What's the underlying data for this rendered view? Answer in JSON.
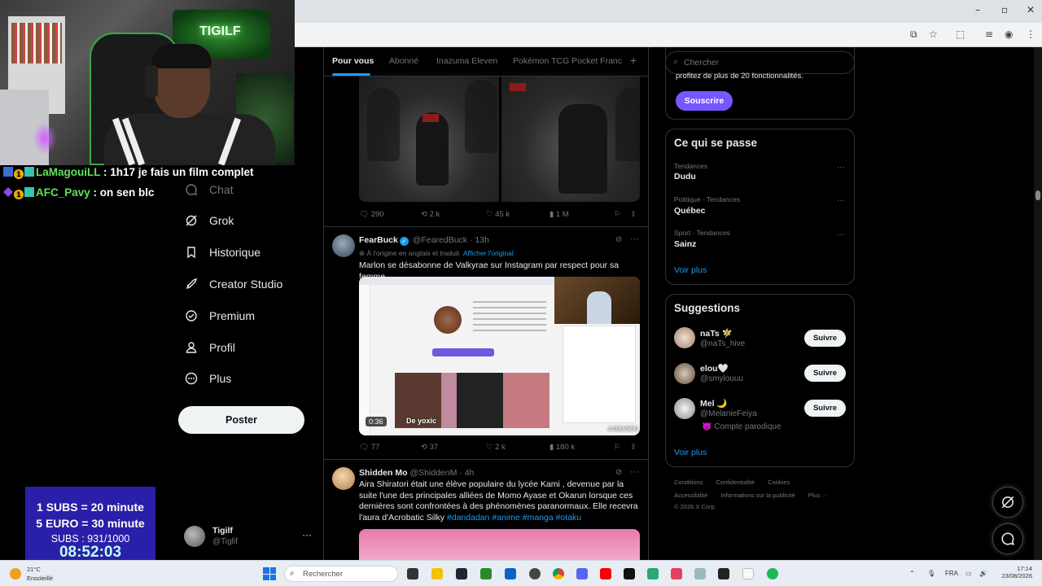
{
  "stream": {
    "chat": [
      {
        "user": "LaMagouiLL",
        "message": " : 1h17 je fais un film complet"
      },
      {
        "user": "AFC_Pavy",
        "message": " : on sen blc"
      }
    ],
    "neon": "TIGILF",
    "subs": {
      "line1": "1 SUBS = 20 minute",
      "line2": "5 EURO = 30 minute",
      "counter": "SUBS : 931/1000",
      "timer": "08:52:03"
    }
  },
  "nav": {
    "items": [
      {
        "label": "Chat",
        "icon": "chat-icon"
      },
      {
        "label": "Grok",
        "icon": "grok-icon"
      },
      {
        "label": "Historique",
        "icon": "bookmark-icon"
      },
      {
        "label": "Creator Studio",
        "icon": "rocket-icon"
      },
      {
        "label": "Premium",
        "icon": "verified-icon"
      },
      {
        "label": "Profil",
        "icon": "person-icon"
      },
      {
        "label": "Plus",
        "icon": "more-circle-icon"
      }
    ],
    "post_button": "Poster",
    "profile": {
      "name": "Tigilf",
      "handle": "@Tiglif",
      "more": "···"
    }
  },
  "feed": {
    "tabs": [
      "Pour vous",
      "Abonné",
      "Inazuma Eleven",
      "Pokémon TCG Pocket Franc"
    ],
    "tab_add": "+",
    "tweet1_stats": {
      "replies": "290",
      "retweets": "2 k",
      "likes": "45 k",
      "views": "1 M"
    },
    "tweet2": {
      "name": "FearBuck",
      "handle": "@FearedBuck",
      "time": "· 13h",
      "translate": "À l'origine en anglais et traduit",
      "translate_link": "Afficher l'original",
      "text": "Marlon se désabonne de Valkyrae sur Instagram par respect pour sa femme",
      "video_time": "0:36",
      "video_watermark": "yoxic",
      "video_text_overlay": "De",
      "video_counter": "4480/500",
      "stats": {
        "replies": "77",
        "retweets": "37",
        "likes": "2 k",
        "views": "180 k"
      }
    },
    "tweet3": {
      "name": "Shidden Mo",
      "handle": "@ShiddenM",
      "time": "· 4h",
      "text": "Aira Shiratori était une élève populaire du lycée Kami , devenue par la suite l'une des principales alliées de Momo Ayase et Okarun lorsque ces dernières sont confrontées à des phénomènes paranormaux. Elle recevra l'aura d'Acrobatic Silky",
      "hashtags": "#dandadan #anime #manga #otaku"
    }
  },
  "sidebar": {
    "search_placeholder": "Chercher",
    "premium_text": "profitez de plus de 20 fonctionnalités.",
    "subscribe_button": "Souscrire",
    "trends_title": "Ce qui se passe",
    "trends": [
      {
        "context": "Tendances",
        "name": "Dudu"
      },
      {
        "context": "Politique · Tendances",
        "name": "Québec"
      },
      {
        "context": "Sport · Tendances",
        "name": "Sainz"
      }
    ],
    "trends_more": "Voir plus",
    "suggestions_title": "Suggestions",
    "suggestions": [
      {
        "name": "naTs 🧚",
        "handle": "@naTs_hive",
        "extra": ""
      },
      {
        "name": "elou🤍",
        "handle": "@smylouuu",
        "extra": ""
      },
      {
        "name": "Mel 🌙",
        "handle": "@MelanieFeiya",
        "extra": "😈 Compte parodique"
      }
    ],
    "follow_button": "Suivre",
    "suggestions_more": "Voir plus",
    "footer_row1": [
      "Conditions",
      "Confidentialité",
      "Cookies"
    ],
    "footer_row2": [
      "Accessibilité",
      "Informations sur la publicité",
      "Plus ···"
    ],
    "copyright": "© 2026 X Corp."
  },
  "taskbar": {
    "temp": "21°C",
    "condition": "Ensoleillé",
    "search": "Rechercher",
    "lang": "FRA",
    "time": "17:14",
    "date": "23/08/2026"
  },
  "colors": {
    "accent": "#1d9bf0",
    "premium": "#7856ff",
    "border": "#2f3336",
    "subs_box": "#2a1fa8"
  }
}
